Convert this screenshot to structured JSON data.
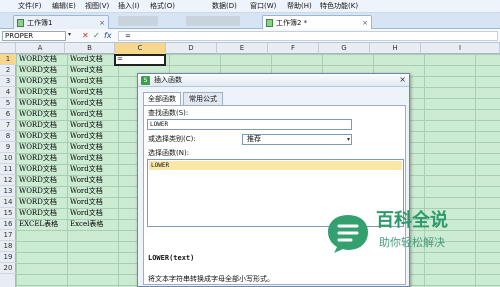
{
  "menu": {
    "file": "文件(F)",
    "edit": "编辑(E)",
    "view": "视图(V)",
    "insert": "插入(I)",
    "format": "格式(O)",
    "data": "数据(D)",
    "window": "窗口(W)",
    "help": "帮助(H)",
    "special": "特色功能(K)"
  },
  "tabs": [
    {
      "label": "工作簿1",
      "close": "×"
    },
    {
      "label": "工作簿2 *",
      "close": "×"
    }
  ],
  "formula_bar": {
    "name_box": "PROPER",
    "dropdown": "▾",
    "cancel": "✕",
    "confirm": "✓",
    "fx": "fx",
    "content": "="
  },
  "columns": [
    "A",
    "B",
    "C",
    "D",
    "E",
    "F",
    "G",
    "H",
    "I"
  ],
  "rows": [
    "1",
    "2",
    "3",
    "4",
    "5",
    "6",
    "7",
    "8",
    "9",
    "10",
    "11",
    "12",
    "13",
    "14",
    "15",
    "16",
    "17",
    "18",
    "19",
    "20"
  ],
  "sheet": {
    "col_a": [
      "WORD文档",
      "WORD文档",
      "WORD文档",
      "WORD文档",
      "WORD文档",
      "WORD文档",
      "WORD文档",
      "WORD文档",
      "WORD文档",
      "WORD文档",
      "WORD文档",
      "WORD文档",
      "WORD文档",
      "WORD文档",
      "WORD文档",
      "EXCEL表格"
    ],
    "col_b": [
      "Word文档",
      "Word文档",
      "Word文档",
      "Word文档",
      "Word文档",
      "Word文档",
      "Word文档",
      "Word文档",
      "Word文档",
      "Word文档",
      "Word文档",
      "Word文档",
      "Word文档",
      "Word文档",
      "Word文档",
      "Excel表格"
    ],
    "active_cell_value": "="
  },
  "dialog": {
    "title": "插入函数",
    "close": "×",
    "tab_all": "全部函数",
    "tab_common": "常用公式",
    "search_label": "查找函数(S):",
    "search_value": "LOWER",
    "category_label": "或选择类别(C):",
    "category_value": "推荐",
    "category_arrow": "▾",
    "list_label": "选择函数(N):",
    "list_items": [
      "LOWER"
    ],
    "signature": "LOWER(text)",
    "description": "将文本字符串转换成字母全部小写形式。"
  },
  "watermark": {
    "main": "百科全说",
    "sub": "助你轻松解决"
  },
  "colors": {
    "sheet_bg": "#ccebd3",
    "selected_header": "#f6d78b",
    "list_highlight": "#fbe8a6",
    "watermark_green": "#2c9a6a"
  }
}
